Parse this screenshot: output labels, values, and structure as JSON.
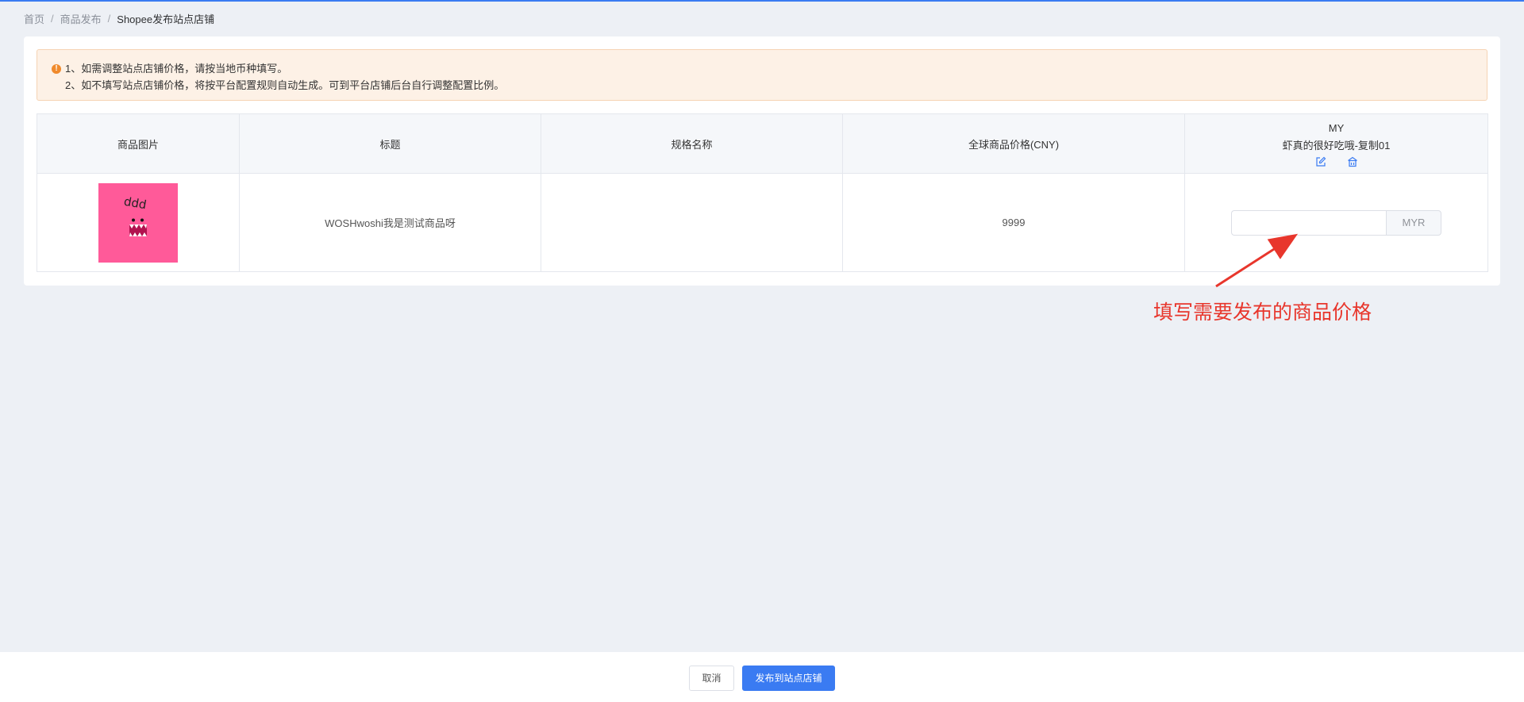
{
  "breadcrumb": {
    "items": [
      "首页",
      "商品发布",
      "Shopee发布站点店铺"
    ],
    "separator": "/"
  },
  "alert": {
    "icon": "warning-icon",
    "line1": "1、如需调整站点店铺价格，请按当地币种填写。",
    "line2": "2、如不填写站点店铺价格，将按平台配置规则自动生成。可到平台店铺后台自行调整配置比例。"
  },
  "table": {
    "headers": {
      "image": "商品图片",
      "title": "标题",
      "spec": "规格名称",
      "global_price": "全球商品价格(CNY)",
      "site": "MY",
      "shop": "虾真的很好吃哦-复制01"
    },
    "rows": [
      {
        "image_text": "ddd",
        "title": "WOSHwoshi我是测试商品呀",
        "spec": "",
        "global_price": "9999",
        "site_price": {
          "value": "",
          "placeholder": "",
          "currency": "MYR"
        }
      }
    ]
  },
  "annotation": {
    "text": "填写需要发布的商品价格",
    "color": "#e8362c"
  },
  "footer": {
    "cancel_label": "取消",
    "publish_label": "发布到站点店铺"
  },
  "colors": {
    "primary": "#3a7bf2",
    "warning": "#f08a2c",
    "alert_bg": "#fdf1e6",
    "thumb_bg": "#ff5a99"
  }
}
